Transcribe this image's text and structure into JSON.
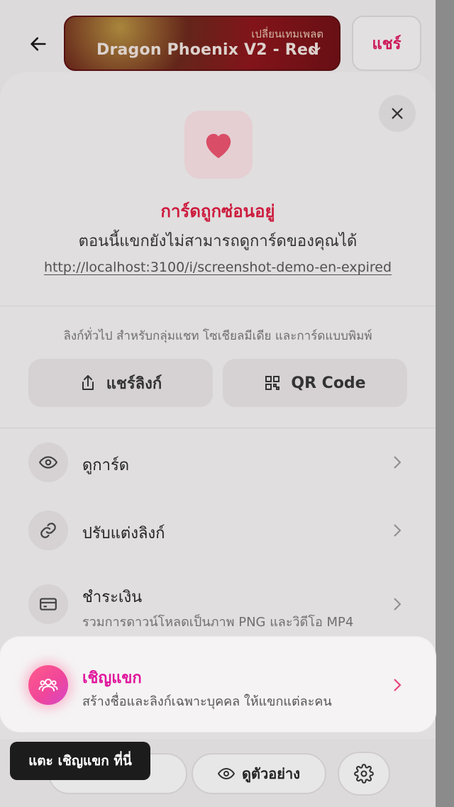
{
  "topbar": {
    "template_switch_label": "เปลี่ยนเทมเพลต",
    "template_name": "Dragon Phoenix V2 - Red",
    "share_label": "แชร์"
  },
  "card_status": {
    "title": "การ์ดถูกซ่อนอยู่",
    "description": "ตอนนี้แขกยังไม่สามารถดูการ์ดของคุณได้",
    "link": "http://localhost:3100/i/screenshot-demo-en-expired"
  },
  "share_section": {
    "caption": "ลิงก์ทั่วไป สำหรับกลุ่มแชท โซเชียลมีเดีย และการ์ดแบบพิมพ์",
    "share_link_label": "แชร์ลิงก์",
    "qr_label": "QR Code"
  },
  "menu": {
    "view_card": "ดูการ์ด",
    "customize_link": "ปรับแต่งลิงก์",
    "payment": "ชำระเงิน",
    "payment_sub": "รวมการดาวน์โหลดเป็นภาพ PNG และวิดีโอ MP4"
  },
  "invite": {
    "title": "เชิญแขก",
    "description": "สร้างชื่อและลิงก์เฉพาะบุคคล ให้แขกแต่ละคน"
  },
  "tooltip": {
    "text": "แตะ เชิญแขก ที่นี่"
  },
  "bottombar": {
    "preview_label": "ดูตัวอย่าง"
  },
  "colors": {
    "accent": "#e2135e",
    "invite_title": "#e0159c",
    "status_red": "#e2193f",
    "heart": "#f0506e"
  }
}
